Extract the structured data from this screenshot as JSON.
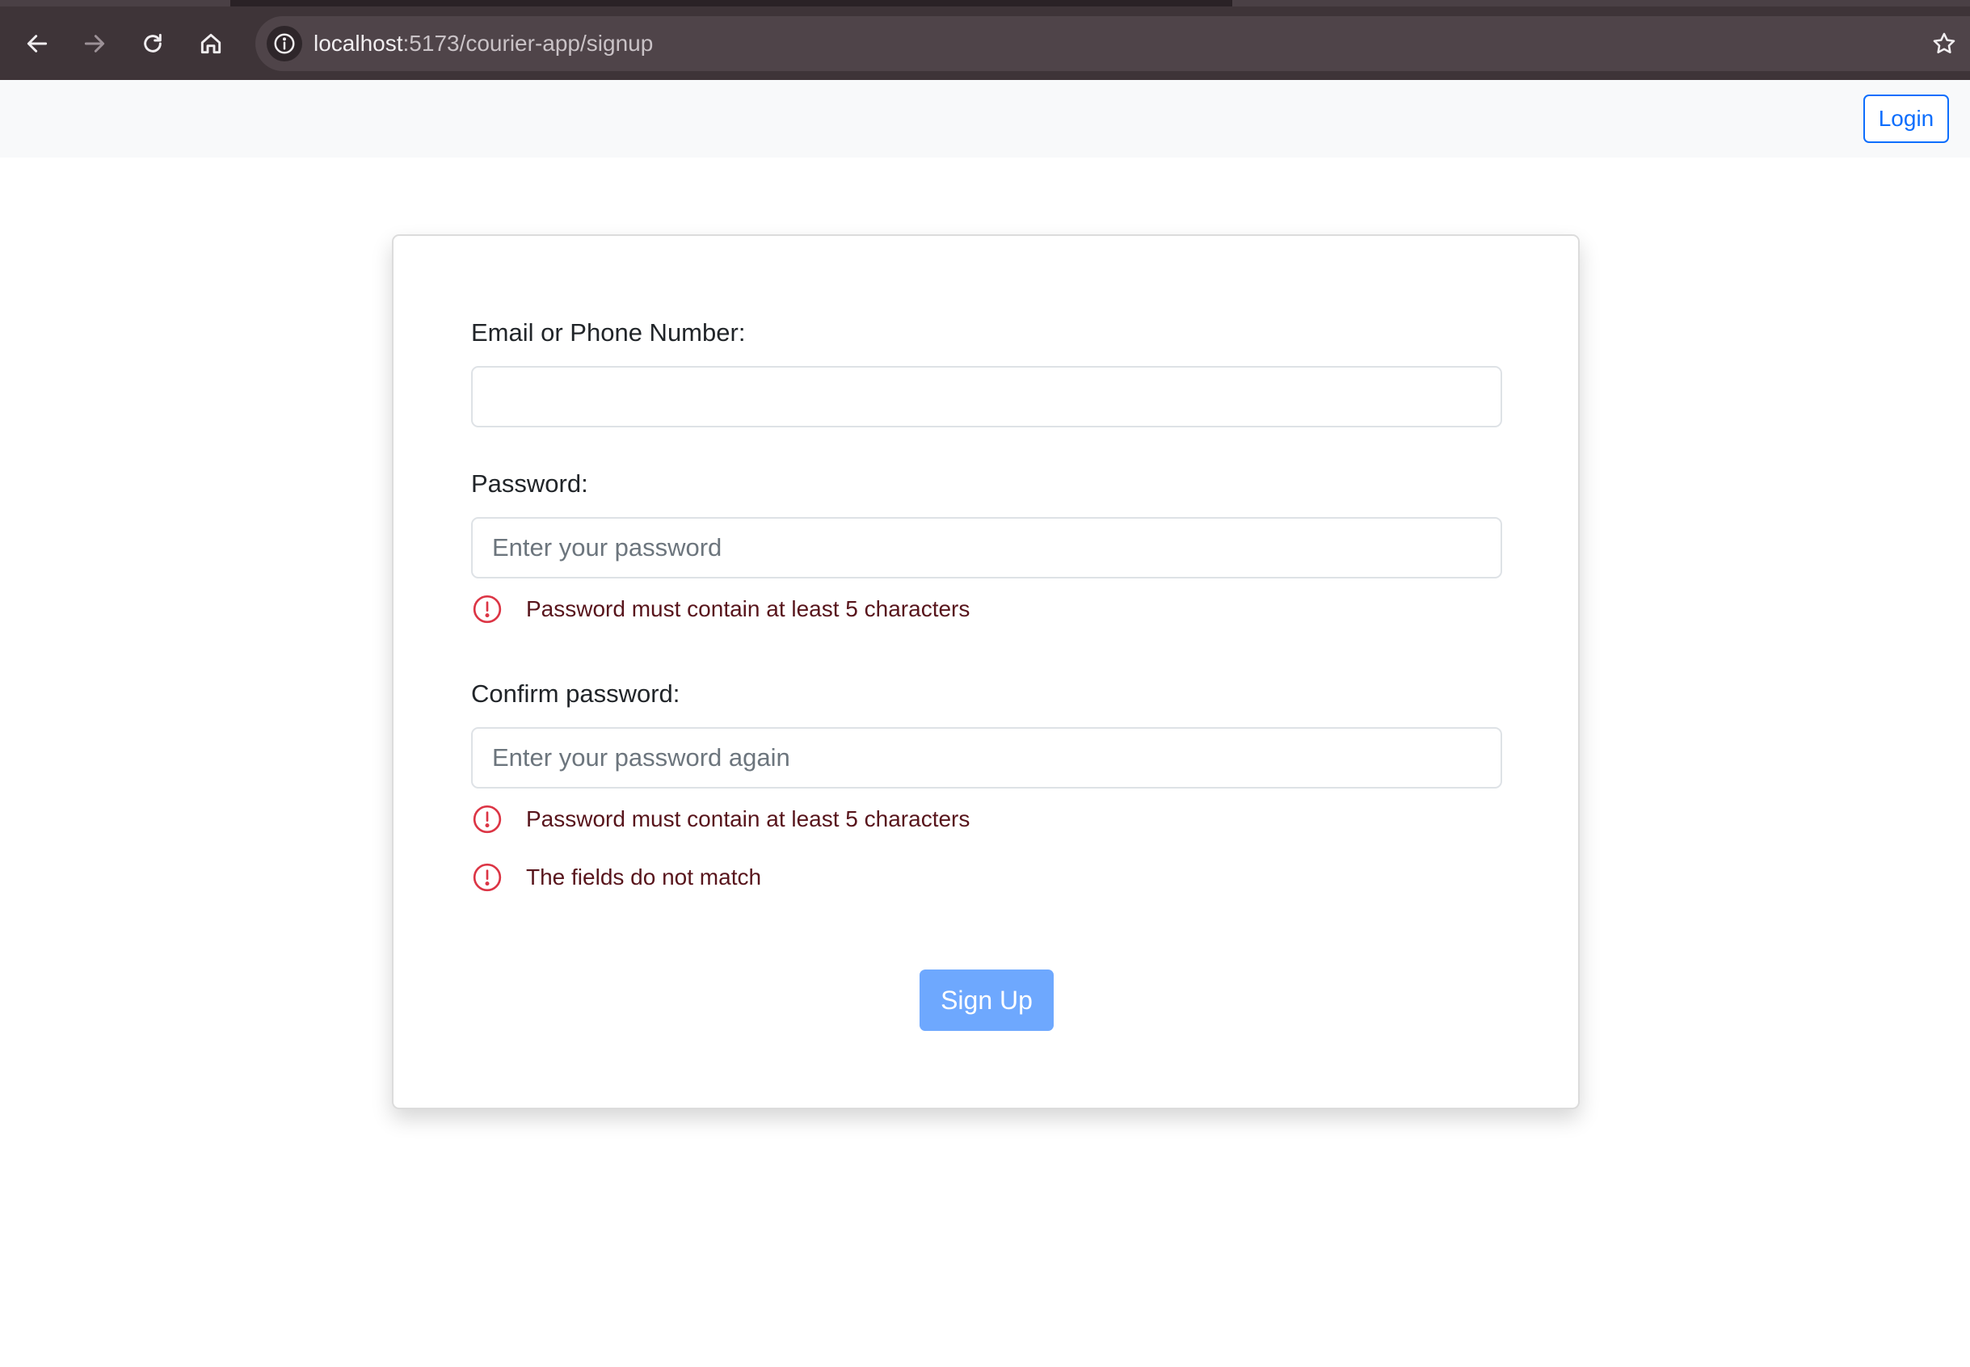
{
  "browser": {
    "url_host": "localhost",
    "url_path": ":5173/courier-app/signup",
    "icons": {
      "back": "arrow-left-icon",
      "forward": "arrow-right-icon",
      "reload": "reload-icon",
      "home": "home-icon",
      "site_info": "info-icon",
      "bookmark": "star-icon"
    }
  },
  "navbar": {
    "login_label": "Login"
  },
  "form": {
    "email": {
      "label": "Email or Phone Number:",
      "value": "",
      "placeholder": ""
    },
    "password": {
      "label": "Password:",
      "value": "",
      "placeholder": "Enter your password",
      "errors": [
        "Password must contain at least 5 characters"
      ]
    },
    "confirm_password": {
      "label": "Confirm password:",
      "value": "",
      "placeholder": "Enter your password again",
      "errors": [
        "Password must contain at least 5 characters",
        "The fields do not match"
      ]
    },
    "submit_label": "Sign Up"
  },
  "colors": {
    "chrome_background": "#3e3438",
    "primary": "#0d6efd",
    "primary_disabled": "#6ea8fe",
    "error_icon": "#dc3545",
    "error_text": "#58151c"
  }
}
